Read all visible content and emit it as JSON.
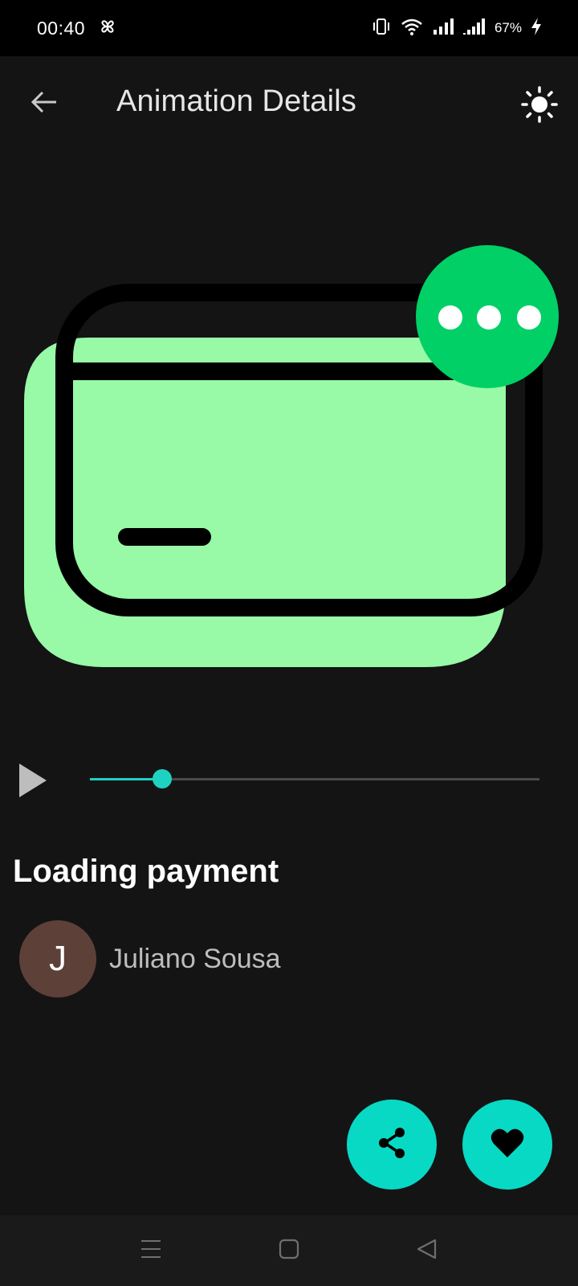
{
  "status_bar": {
    "time": "00:40",
    "battery_percent": "67%",
    "icons": [
      "pinwheel-icon",
      "vibrate-icon",
      "wifi-icon",
      "signal-icon",
      "signal-icon",
      "charging-icon"
    ]
  },
  "header": {
    "title": "Animation Details",
    "back_icon": "arrow-left-icon",
    "theme_icon": "sun-icon"
  },
  "animation": {
    "subject": "card-loading-illustration",
    "colors": {
      "card_fill": "#98f9a6",
      "outline": "#000000",
      "badge": "#00d066",
      "dots": "#ffffff"
    }
  },
  "player": {
    "play_icon": "play-icon",
    "progress": 0.16,
    "accent": "#1fd1c1"
  },
  "details": {
    "title": "Loading payment",
    "author_initial": "J",
    "author_name": "Juliano Sousa"
  },
  "actions": {
    "share_icon": "share-icon",
    "like_icon": "heart-icon",
    "fab_color": "#08d9c5"
  },
  "nav": {
    "icons": [
      "menu-icon",
      "home-square-icon",
      "back-triangle-icon"
    ]
  }
}
